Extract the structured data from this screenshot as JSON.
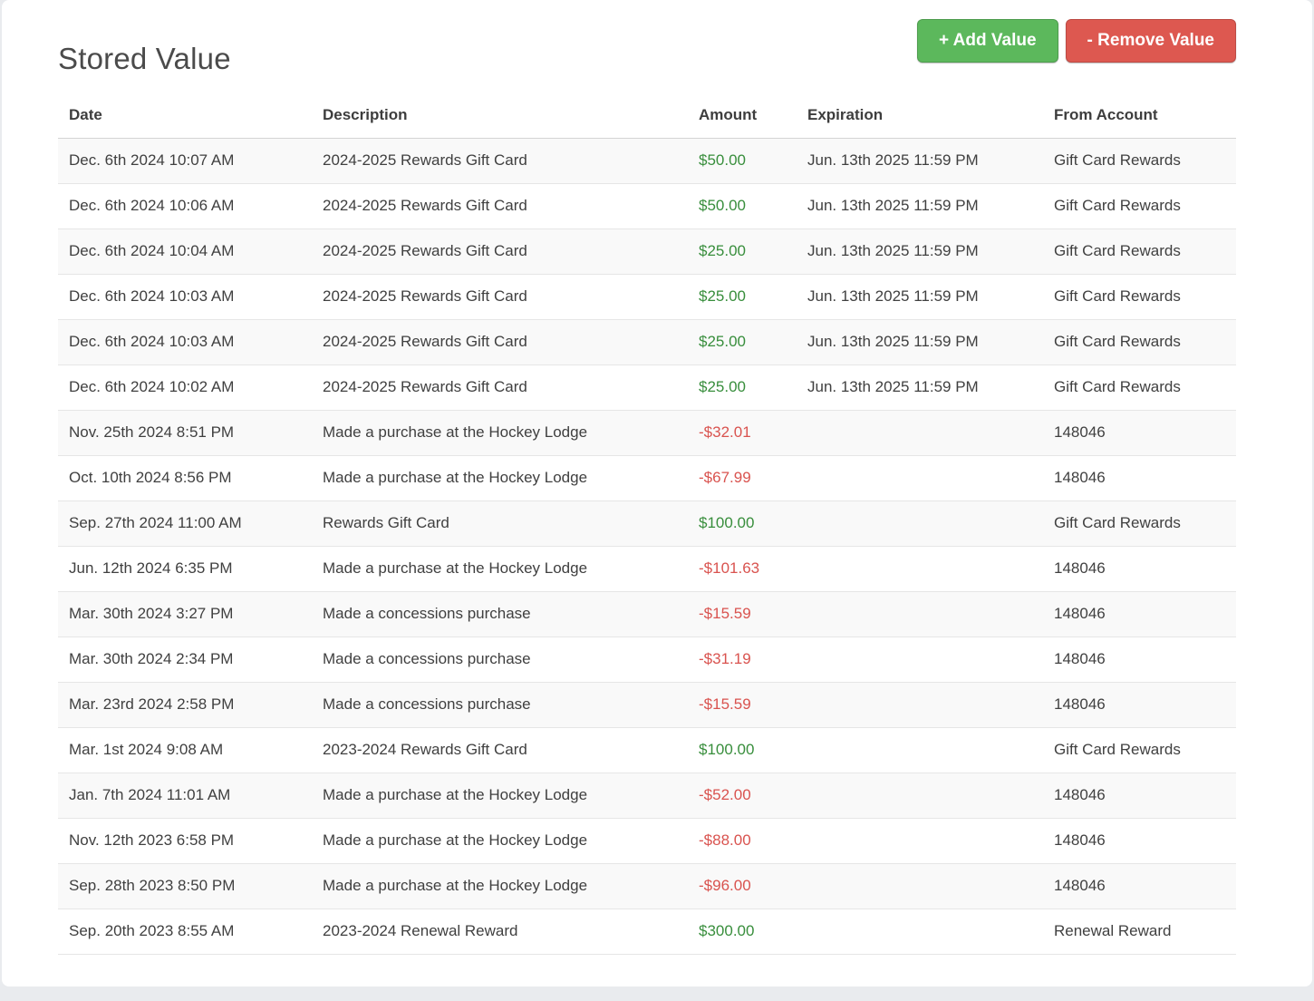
{
  "page": {
    "title": "Stored Value"
  },
  "toolbar": {
    "add_label": "+ Add Value",
    "remove_label": "- Remove Value"
  },
  "colors": {
    "positive_amount": "#388e3c",
    "negative_amount": "#d9534f",
    "add_button": "#5cb85c",
    "remove_button": "#dd5850"
  },
  "table": {
    "columns": [
      "Date",
      "Description",
      "Amount",
      "Expiration",
      "From Account"
    ],
    "rows": [
      {
        "date": "Dec. 6th 2024 10:07 AM",
        "description": "2024-2025 Rewards Gift Card",
        "amount": "$50.00",
        "expiration": "Jun. 13th 2025 11:59 PM",
        "from_account": "Gift Card Rewards"
      },
      {
        "date": "Dec. 6th 2024 10:06 AM",
        "description": "2024-2025 Rewards Gift Card",
        "amount": "$50.00",
        "expiration": "Jun. 13th 2025 11:59 PM",
        "from_account": "Gift Card Rewards"
      },
      {
        "date": "Dec. 6th 2024 10:04 AM",
        "description": "2024-2025 Rewards Gift Card",
        "amount": "$25.00",
        "expiration": "Jun. 13th 2025 11:59 PM",
        "from_account": "Gift Card Rewards"
      },
      {
        "date": "Dec. 6th 2024 10:03 AM",
        "description": "2024-2025 Rewards Gift Card",
        "amount": "$25.00",
        "expiration": "Jun. 13th 2025 11:59 PM",
        "from_account": "Gift Card Rewards"
      },
      {
        "date": "Dec. 6th 2024 10:03 AM",
        "description": "2024-2025 Rewards Gift Card",
        "amount": "$25.00",
        "expiration": "Jun. 13th 2025 11:59 PM",
        "from_account": "Gift Card Rewards"
      },
      {
        "date": "Dec. 6th 2024 10:02 AM",
        "description": "2024-2025 Rewards Gift Card",
        "amount": "$25.00",
        "expiration": "Jun. 13th 2025 11:59 PM",
        "from_account": "Gift Card Rewards"
      },
      {
        "date": "Nov. 25th 2024 8:51 PM",
        "description": "Made a purchase at the Hockey Lodge",
        "amount": "-$32.01",
        "expiration": "",
        "from_account": "148046"
      },
      {
        "date": "Oct. 10th 2024 8:56 PM",
        "description": "Made a purchase at the Hockey Lodge",
        "amount": "-$67.99",
        "expiration": "",
        "from_account": "148046"
      },
      {
        "date": "Sep. 27th 2024 11:00 AM",
        "description": "Rewards Gift Card",
        "amount": "$100.00",
        "expiration": "",
        "from_account": "Gift Card Rewards"
      },
      {
        "date": "Jun. 12th 2024 6:35 PM",
        "description": "Made a purchase at the Hockey Lodge",
        "amount": "-$101.63",
        "expiration": "",
        "from_account": "148046"
      },
      {
        "date": "Mar. 30th 2024 3:27 PM",
        "description": "Made a concessions purchase",
        "amount": "-$15.59",
        "expiration": "",
        "from_account": "148046"
      },
      {
        "date": "Mar. 30th 2024 2:34 PM",
        "description": "Made a concessions purchase",
        "amount": "-$31.19",
        "expiration": "",
        "from_account": "148046"
      },
      {
        "date": "Mar. 23rd 2024 2:58 PM",
        "description": "Made a concessions purchase",
        "amount": "-$15.59",
        "expiration": "",
        "from_account": "148046"
      },
      {
        "date": "Mar. 1st 2024 9:08 AM",
        "description": "2023-2024 Rewards Gift Card",
        "amount": "$100.00",
        "expiration": "",
        "from_account": "Gift Card Rewards"
      },
      {
        "date": "Jan. 7th 2024 11:01 AM",
        "description": "Made a purchase at the Hockey Lodge",
        "amount": "-$52.00",
        "expiration": "",
        "from_account": "148046"
      },
      {
        "date": "Nov. 12th 2023 6:58 PM",
        "description": "Made a purchase at the Hockey Lodge",
        "amount": "-$88.00",
        "expiration": "",
        "from_account": "148046"
      },
      {
        "date": "Sep. 28th 2023 8:50 PM",
        "description": "Made a purchase at the Hockey Lodge",
        "amount": "-$96.00",
        "expiration": "",
        "from_account": "148046"
      },
      {
        "date": "Sep. 20th 2023 8:55 AM",
        "description": "2023-2024 Renewal Reward",
        "amount": "$300.00",
        "expiration": "",
        "from_account": "Renewal Reward"
      }
    ]
  }
}
